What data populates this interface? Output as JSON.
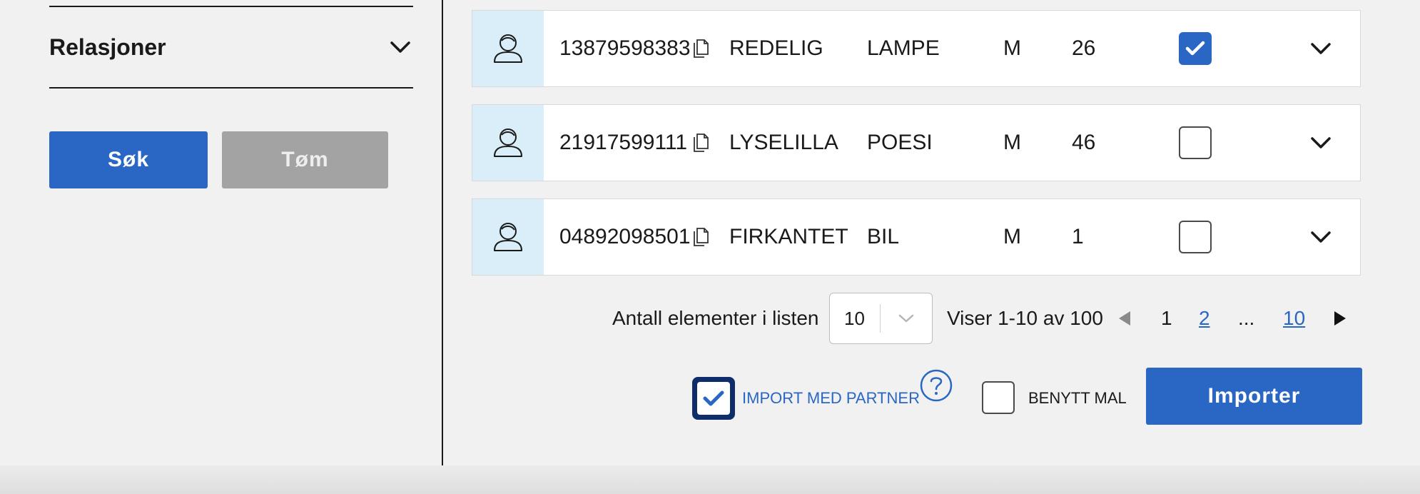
{
  "filters": {
    "relations_label": "Relasjoner",
    "search_button": "Søk",
    "clear_button": "Tøm"
  },
  "results": [
    {
      "id": "13879598383",
      "first_name": "REDELIG",
      "last_name": "LAMPE",
      "sex": "M",
      "age": "26",
      "selected": true
    },
    {
      "id": "21917599111",
      "first_name": "LYSELILLA",
      "last_name": "POESI",
      "sex": "M",
      "age": "46",
      "selected": false
    },
    {
      "id": "04892098501",
      "first_name": "FIRKANTET",
      "last_name": "BIL",
      "sex": "M",
      "age": "1",
      "selected": false
    }
  ],
  "pagination": {
    "items_label": "Antall elementer i listen",
    "page_size": "10",
    "range_text": "Viser 1-10 av 100",
    "current_page": "1",
    "page_2": "2",
    "ellipsis": "...",
    "last_page": "10"
  },
  "actions": {
    "import_with_partner_label": "IMPORT MED PARTNER",
    "import_with_partner_checked": true,
    "use_template_label": "BENYTT MAL",
    "use_template_checked": false,
    "import_button": "Importer"
  },
  "colors": {
    "primary": "#2a67c4",
    "avatar_bg": "#d9eef8",
    "disabled_button": "#a3a3a3"
  }
}
